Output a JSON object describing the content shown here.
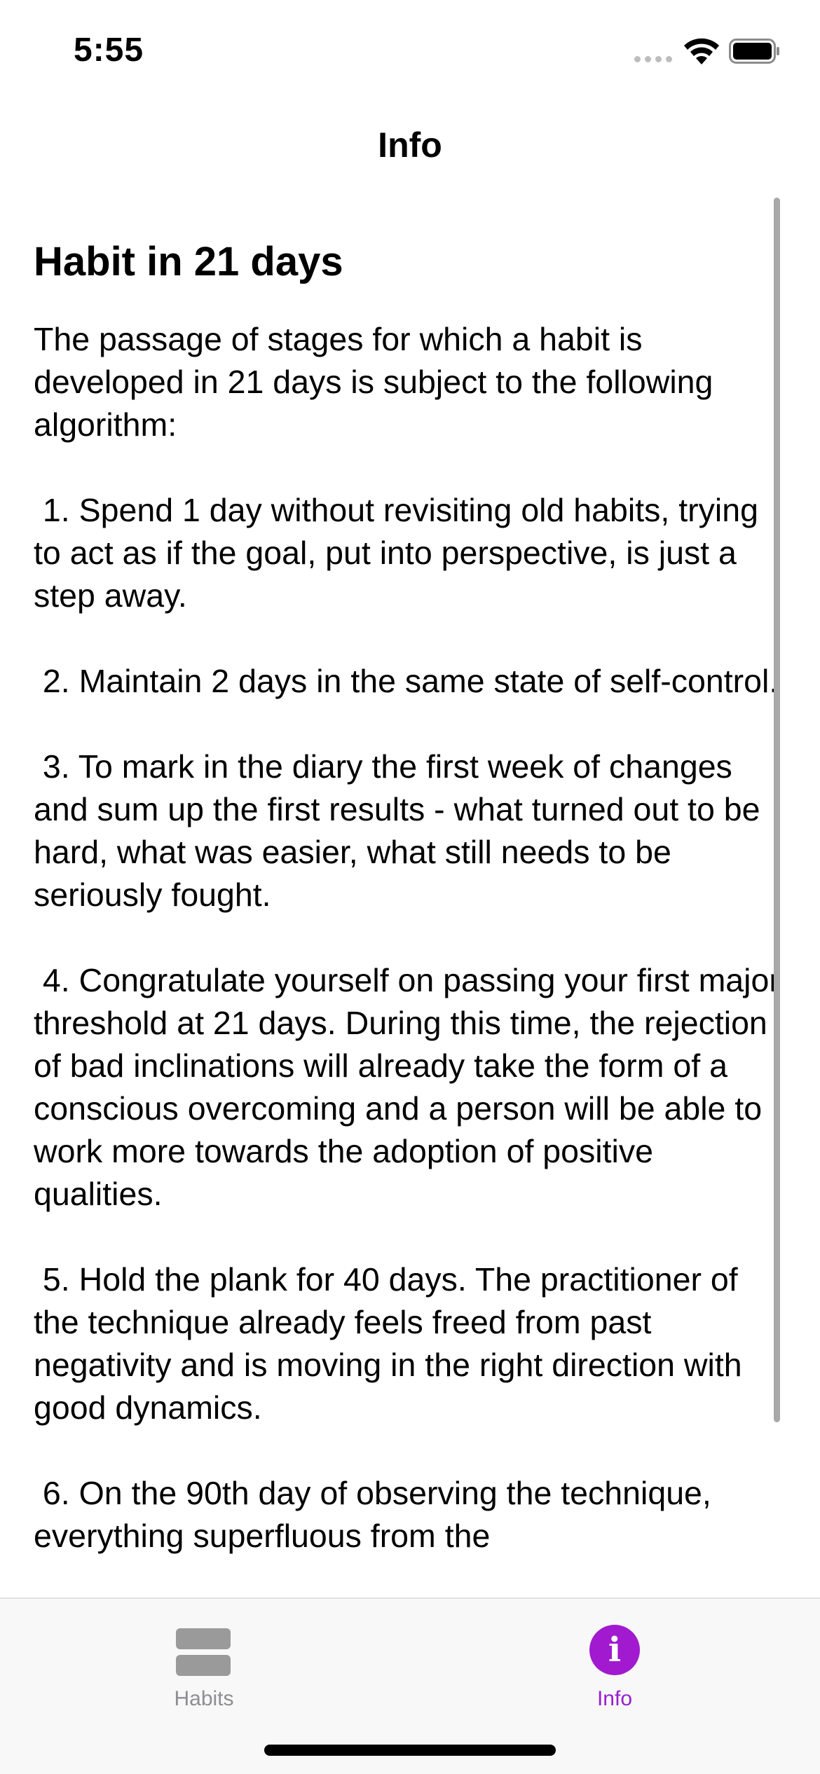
{
  "status_bar": {
    "time": "5:55"
  },
  "nav": {
    "title": "Info"
  },
  "article": {
    "heading": "Habit in 21 days",
    "body": "The passage of stages for which a habit is developed in 21 days is subject to the following algorithm:\n\n 1. Spend 1 day without revisiting old habits, trying to act as if the goal, put into perspective, is just a step away.\n\n 2. Maintain 2 days in the same state of self-control.\n\n 3. To mark in the diary the first week of changes and sum up the first results - what turned out to be hard, what was easier, what still needs to be seriously fought.\n\n 4. Congratulate yourself on passing your first major threshold at 21 days. During this time, the rejection of bad inclinations will already take the form of a conscious overcoming and a person will be able to work more towards the adoption of positive qualities.\n\n 5. Hold the plank for 40 days. The practitioner of the technique already feels freed from past negativity and is moving in the right direction with good dynamics.\n\n 6. On the 90th day of observing the technique, everything superfluous from the"
  },
  "tab_bar": {
    "tabs": [
      {
        "label": "Habits",
        "icon": "habits-stack-icon",
        "selected": false
      },
      {
        "label": "Info",
        "icon": "info-circle-icon",
        "selected": true
      }
    ]
  },
  "colors": {
    "accent": "#A11AD0",
    "inactive_tab": "#8E8E93",
    "tab_bar_bg": "#F8F8F8"
  }
}
